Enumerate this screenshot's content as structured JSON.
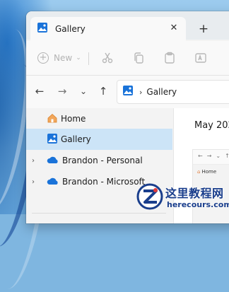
{
  "window": {
    "tab_title": "Gallery",
    "close_glyph": "✕",
    "new_tab_glyph": "+"
  },
  "toolbar": {
    "new_label": "New",
    "new_caret": "⌄"
  },
  "addressbar": {
    "back": "←",
    "forward": "→",
    "recent": "⌄",
    "up": "↑",
    "separator": "›",
    "crumb": "Gallery"
  },
  "sidebar": {
    "items": [
      {
        "label": "Home",
        "icon": "home-icon"
      },
      {
        "label": "Gallery",
        "icon": "gallery-icon",
        "selected": true
      },
      {
        "label": "Brandon - Personal",
        "icon": "onedrive-icon",
        "expander": "›"
      },
      {
        "label": "Brandon - Microsoft",
        "icon": "onedrive-icon",
        "expander": "›"
      }
    ]
  },
  "content": {
    "month_heading": "May 202",
    "thumbnail": {
      "nav_glyphs": "←→⌄↑",
      "home_label": "Home"
    }
  },
  "watermark": {
    "title": "这里教程网",
    "url": "herecours.com"
  },
  "colors": {
    "selection": "#cce4f7",
    "accent_blue": "#1a73d9",
    "watermark_blue": "#1a3e8c"
  }
}
